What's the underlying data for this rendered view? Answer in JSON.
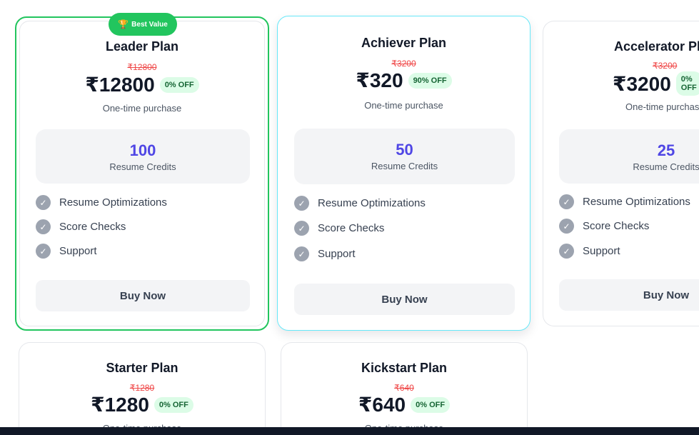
{
  "best_value_badge": {
    "icon": "trophy-icon",
    "label": "Best Value"
  },
  "common": {
    "one_time": "One-time purchase",
    "credits_label": "Resume Credits",
    "buy_label": "Buy Now",
    "features": [
      "Resume Optimizations",
      "Score Checks",
      "Support"
    ]
  },
  "plans": [
    {
      "name": "Leader Plan",
      "original_price": "₹12800",
      "price": "₹12800",
      "discount": "0% OFF",
      "credits": "100"
    },
    {
      "name": "Achiever Plan",
      "original_price": "₹3200",
      "price": "₹320",
      "discount": "90% OFF",
      "credits": "50"
    },
    {
      "name": "Accelerator Plan",
      "original_price": "₹3200",
      "price": "₹3200",
      "discount": "0% OFF",
      "credits": "25"
    },
    {
      "name": "Starter Plan",
      "original_price": "₹1280",
      "price": "₹1280",
      "discount": "0% OFF"
    },
    {
      "name": "Kickstart Plan",
      "original_price": "₹640",
      "price": "₹640",
      "discount": "0% OFF"
    }
  ],
  "colors": {
    "badge_green": "#22c55e",
    "credits_number": "#4f46e5",
    "strike_price": "#ef4444",
    "discount_bg": "#dcfce7",
    "highlight_border": "#67e8f9"
  }
}
